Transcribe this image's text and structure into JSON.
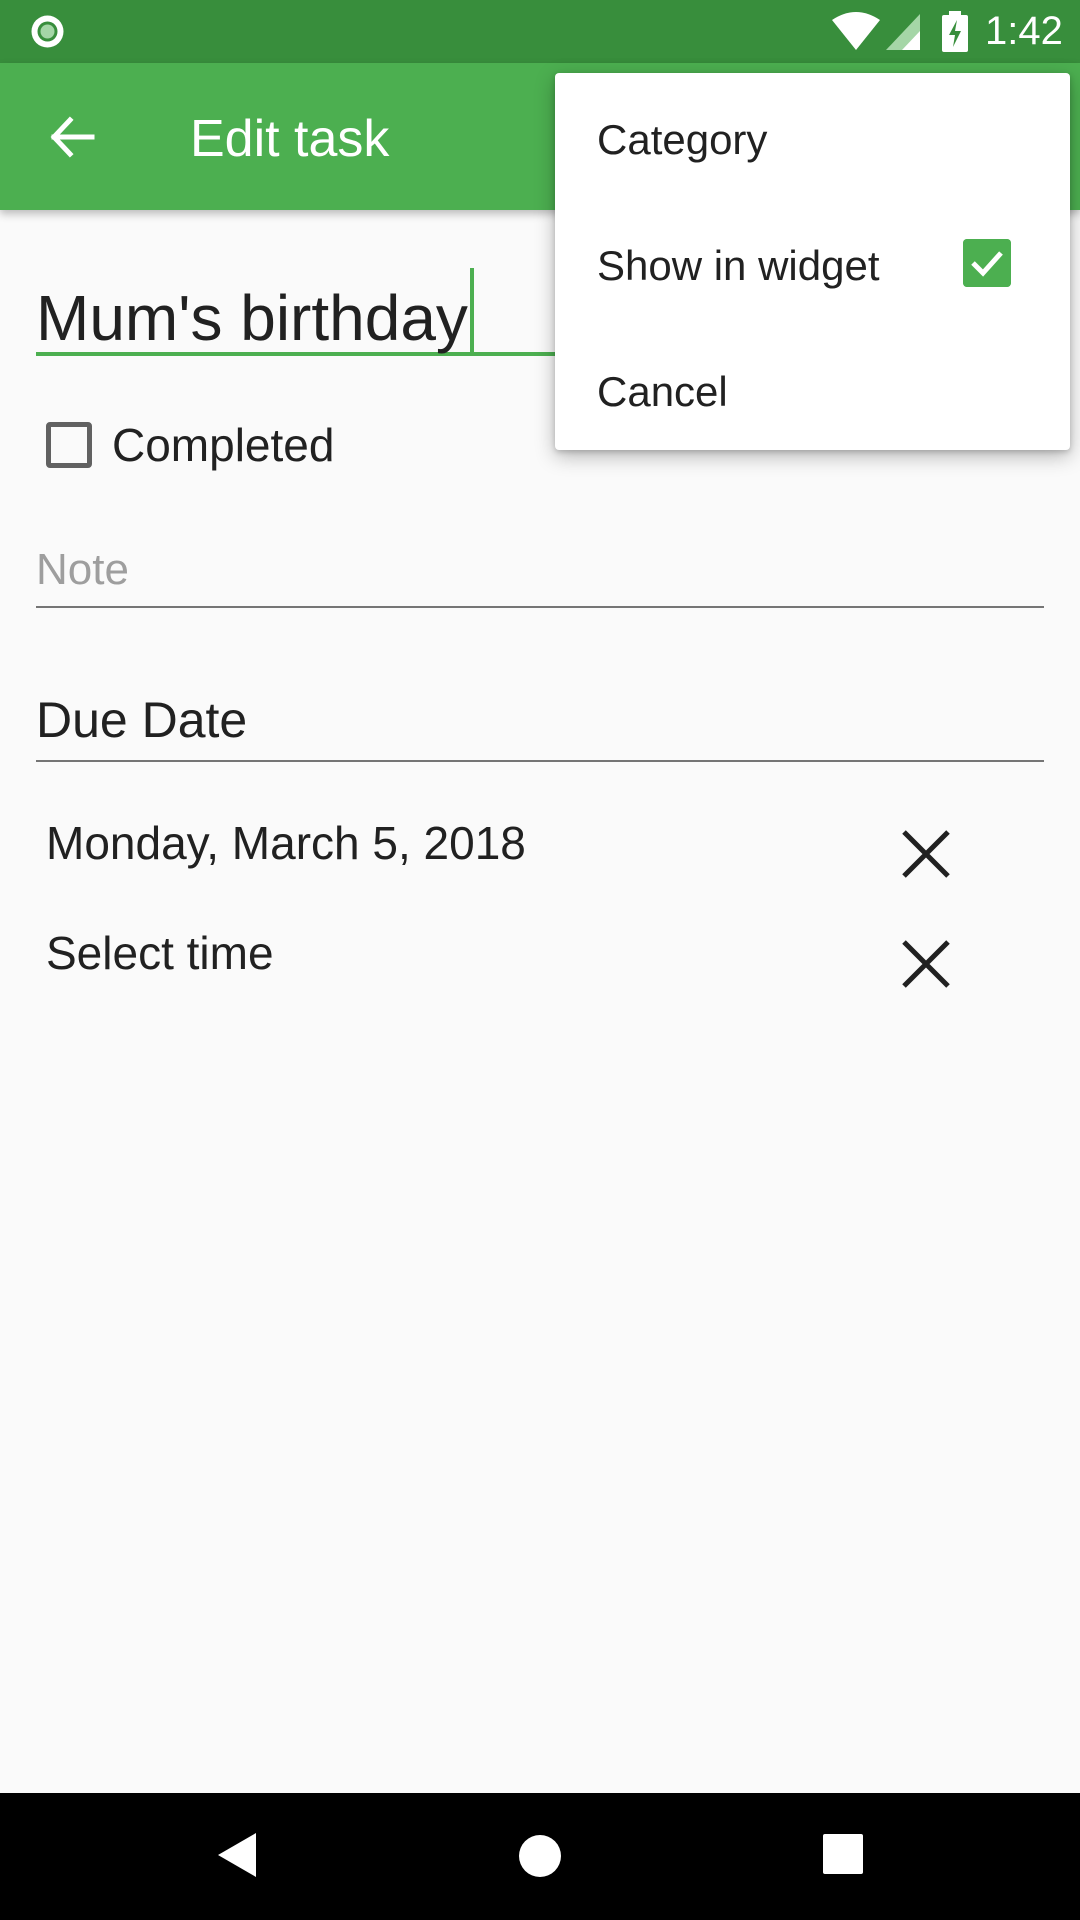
{
  "status_bar": {
    "time": "1:42",
    "icons": [
      "notification-circle-icon",
      "wifi-icon",
      "signal-icon",
      "battery-charging-icon"
    ]
  },
  "app_bar": {
    "back_icon": "arrow-back-icon",
    "title": "Edit task",
    "color": "#4caf50"
  },
  "form": {
    "task_title": "Mum's birthday",
    "completed_label": "Completed",
    "completed_checked": false,
    "note_placeholder": "Note",
    "due_date_label": "Due Date",
    "date_value": "Monday, March 5, 2018",
    "time_value": "Select time",
    "clear_icon": "close-icon"
  },
  "menu": {
    "items": [
      {
        "label": "Category"
      },
      {
        "label": "Show in widget",
        "checked": true
      },
      {
        "label": "Cancel"
      }
    ]
  },
  "nav_bar": {
    "icons": [
      "nav-back-icon",
      "nav-home-icon",
      "nav-recents-icon"
    ]
  },
  "colors": {
    "status_bar": "#388e3c",
    "app_bar": "#4caf50",
    "accent": "#4caf50",
    "background": "#fafafa"
  }
}
